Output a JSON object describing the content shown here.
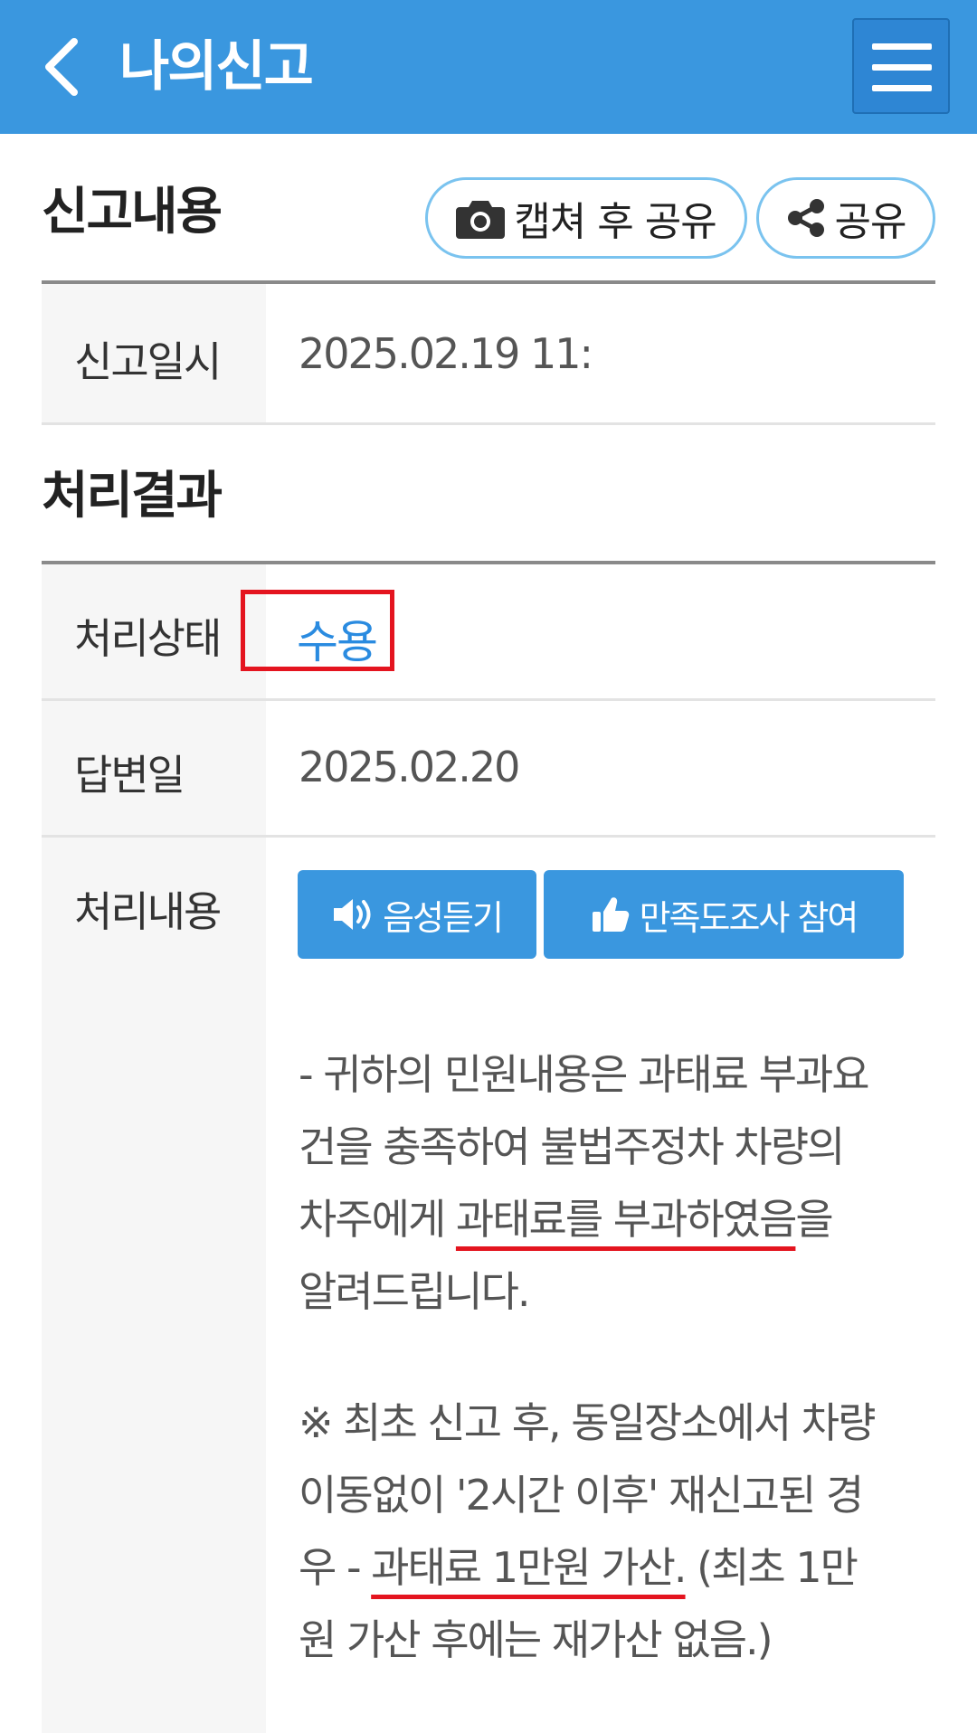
{
  "header": {
    "title": "나의신고",
    "back_icon": "chevron-left-icon",
    "menu_icon": "hamburger-icon"
  },
  "report": {
    "section_title": "신고내용",
    "capture_share_label": "캡쳐 후 공유",
    "share_label": "공유",
    "date_label": "신고일시",
    "date_value": "2025.02.19 11:"
  },
  "result": {
    "section_title": "처리결과",
    "status_label": "처리상태",
    "status_value": "수용",
    "answer_date_label": "답변일",
    "answer_date_value": "2025.02.20",
    "content_label": "처리내용",
    "listen_button": "음성듣기",
    "survey_button": "만족도조사 참여",
    "paragraph1": {
      "line1": "- 귀하의 민원내용은 과태료 부과요",
      "line2": "건을 충족하여 불법주정차 차량의",
      "line3_pre": "차주에게 ",
      "line3_ul": "과태료를 부과하였음",
      "line3_post": "을",
      "line4": "알려드립니다."
    },
    "paragraph2": {
      "line1": "※ 최초 신고 후, 동일장소에서 차량",
      "line2": "이동없이 '2시간 이후' 재신고된 경",
      "line3_pre": "우 - ",
      "line3_ul": "과태료 1만원 가산.",
      "line3_post": " (최초 1만",
      "line4": "원 가산 후에는 재가산 없음.)"
    }
  },
  "colors": {
    "header_bg": "#3a97df",
    "status_text": "#2a8be0",
    "highlight": "#e4141f"
  }
}
